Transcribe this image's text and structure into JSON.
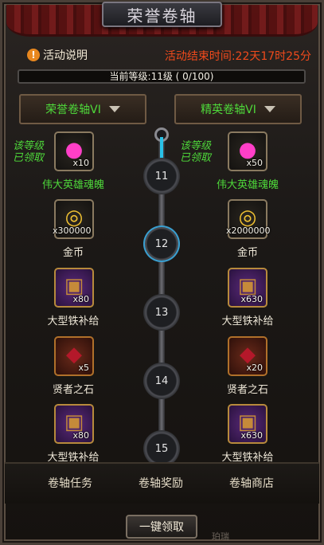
{
  "window": {
    "title": "荣誉卷轴"
  },
  "header": {
    "help_icon": "exclamation-icon",
    "help_label": "活动说明",
    "countdown": "活动结束时间:22天17时25分"
  },
  "level": {
    "text": "当前等级:11级 ( 0/100)",
    "progress": 0
  },
  "dropdowns": {
    "left": "荣誉卷轴VI",
    "right": "精英卷轴VI"
  },
  "claimed_label": "该等级\n已领取",
  "levels": [
    {
      "num": "11",
      "left": {
        "icon": "soul-orb-icon",
        "qty": "x10",
        "name": "伟大英雄魂魄"
      },
      "right": {
        "icon": "soul-orb-icon",
        "qty": "x50",
        "name": "伟大英雄魂魄"
      }
    },
    {
      "num": "12",
      "left": {
        "icon": "gold-coins-icon",
        "qty": "x300000",
        "name": "金币"
      },
      "right": {
        "icon": "gold-coins-icon",
        "qty": "x2000000",
        "name": "金币"
      }
    },
    {
      "num": "13",
      "left": {
        "icon": "treasure-chest-icon",
        "qty": "x80",
        "name": "大型铁补给"
      },
      "right": {
        "icon": "treasure-chest-icon",
        "qty": "x630",
        "name": "大型铁补给"
      }
    },
    {
      "num": "14",
      "left": {
        "icon": "red-gem-icon",
        "qty": "x5",
        "name": "贤者之石"
      },
      "right": {
        "icon": "red-gem-icon",
        "qty": "x20",
        "name": "贤者之石"
      }
    },
    {
      "num": "15",
      "left": {
        "icon": "treasure-chest-icon",
        "qty": "x80",
        "name": "大型铁补给"
      },
      "right": {
        "icon": "treasure-chest-icon",
        "qty": "x630",
        "name": "大型铁补给"
      }
    }
  ],
  "tabs": [
    "卷轴任务",
    "卷轴奖励",
    "卷轴商店"
  ],
  "claim_all": "一键领取",
  "watermark": "珀瑞",
  "colors": {
    "accent_green": "#4ed83a",
    "countdown_red": "#f04a1c",
    "active_track": "#29c1e6"
  }
}
